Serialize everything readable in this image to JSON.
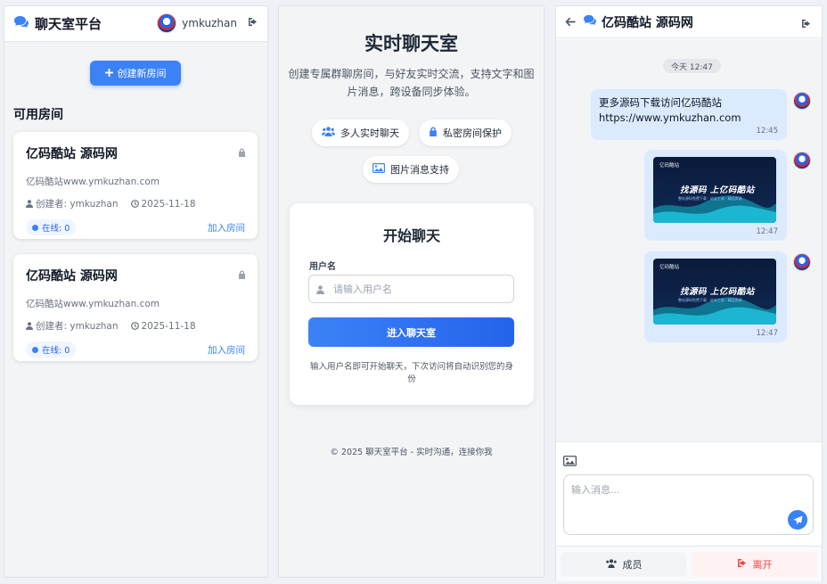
{
  "left": {
    "brand": "聊天室平台",
    "username": "ymkuzhan",
    "create_button": "创建新房间",
    "section_title": "可用房间",
    "rooms": [
      {
        "name": "亿码酷站 源码网",
        "desc": "亿码酷站www.ymkuzhan.com",
        "creator": "创建者: ymkuzhan",
        "date": "2025-11-18",
        "online": "在线: 0",
        "join": "加入房间"
      },
      {
        "name": "亿码酷站 源码网",
        "desc": "亿码酷站www.ymkuzhan.com",
        "creator": "创建者: ymkuzhan",
        "date": "2025-11-18",
        "online": "在线: 0",
        "join": "加入房间"
      }
    ]
  },
  "middle": {
    "title": "实时聊天室",
    "subtitle": "创建专属群聊房间，与好友实时交流，支持文字和图片消息，跨设备同步体验。",
    "features": [
      "多人实时聊天",
      "私密房间保护",
      "图片消息支持"
    ],
    "login": {
      "title": "开始聊天",
      "label": "用户名",
      "placeholder": "请输入用户名",
      "button": "进入聊天室",
      "hint": "输入用户名即可开始聊天，下次访问将自动识别您的身份"
    },
    "footer": "© 2025 聊天室平台 - 实时沟通，连接你我"
  },
  "right": {
    "room_title": "亿码酷站 源码网",
    "date_label": "今天 12:47",
    "messages": [
      {
        "type": "text",
        "text": "更多源码下载访问亿码酷站 https://www.ymkuzhan.com",
        "time": "12:45"
      },
      {
        "type": "image",
        "logo": "亿码酷站",
        "headline": "找源码 上亿码酷站",
        "sub": "整站源码免费下载 · 站长工具 · 精品资源",
        "time": "12:47"
      },
      {
        "type": "image",
        "logo": "亿码酷站",
        "headline": "找源码 上亿码酷站",
        "sub": "整站源码免费下载 · 站长工具 · 精品资源",
        "time": "12:47"
      }
    ],
    "input_placeholder": "输入消息...",
    "members_button": "成员",
    "leave_button": "离开"
  },
  "colors": {
    "accent": "#3b82f6",
    "danger": "#ef4444",
    "bubble": "#dbeafe"
  },
  "icons": [
    "comments-icon",
    "sign-out-icon",
    "plus-icon",
    "lock-icon",
    "user-icon",
    "clock-icon",
    "users-icon",
    "image-icon",
    "arrow-left-icon",
    "send-icon"
  ]
}
